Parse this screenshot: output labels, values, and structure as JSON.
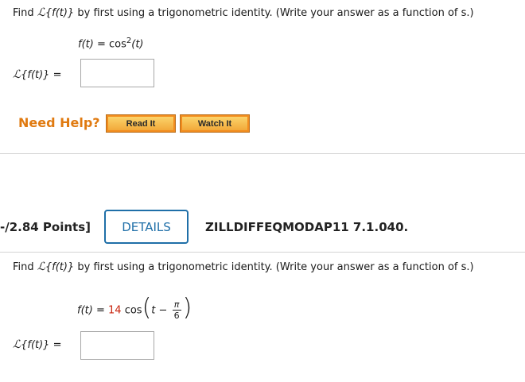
{
  "q1": {
    "instruction": {
      "prefix": "Find ",
      "transform_symbol": "ℒ",
      "transform_arg": "{f(t)}",
      "suffix": " by first using a trigonometric identity. (Write your answer as a function of s.)"
    },
    "formula": {
      "lhs": "f(t)",
      "equals": " = ",
      "func": "cos",
      "power": "2",
      "arg": "(t)"
    },
    "answer_label": {
      "symbol": "ℒ",
      "arg": "{f(t)}",
      "equals": " ="
    },
    "answer_value": ""
  },
  "help": {
    "label": "Need Help?",
    "read_it": "Read It",
    "watch_it": "Watch It"
  },
  "q2": {
    "points": "-/2.84 Points]",
    "details_button": "DETAILS",
    "question_id": "ZILLDIFFEQMODAP11 7.1.040.",
    "instruction": {
      "prefix": "Find ",
      "transform_symbol": "ℒ",
      "transform_arg": "{f(t)}",
      "suffix": " by first using a trigonometric identity. (Write your answer as a function of s.)"
    },
    "formula": {
      "lhs": "f(t)",
      "equals": " = ",
      "coefficient": "14",
      "func": "cos",
      "open_paren": "(",
      "var": "t",
      "minus": " − ",
      "frac_num": "π",
      "frac_den": "6",
      "close_paren": ")"
    },
    "answer_label": {
      "symbol": "ℒ",
      "arg": "{f(t)}",
      "equals": " ="
    },
    "answer_value": ""
  },
  "colors": {
    "coefficient": "#c8230d",
    "need_help": "#e07a10",
    "details_border": "#1f6fa8",
    "button_gradient_top": "#fbd36a",
    "button_gradient_bottom": "#f2a93a"
  }
}
